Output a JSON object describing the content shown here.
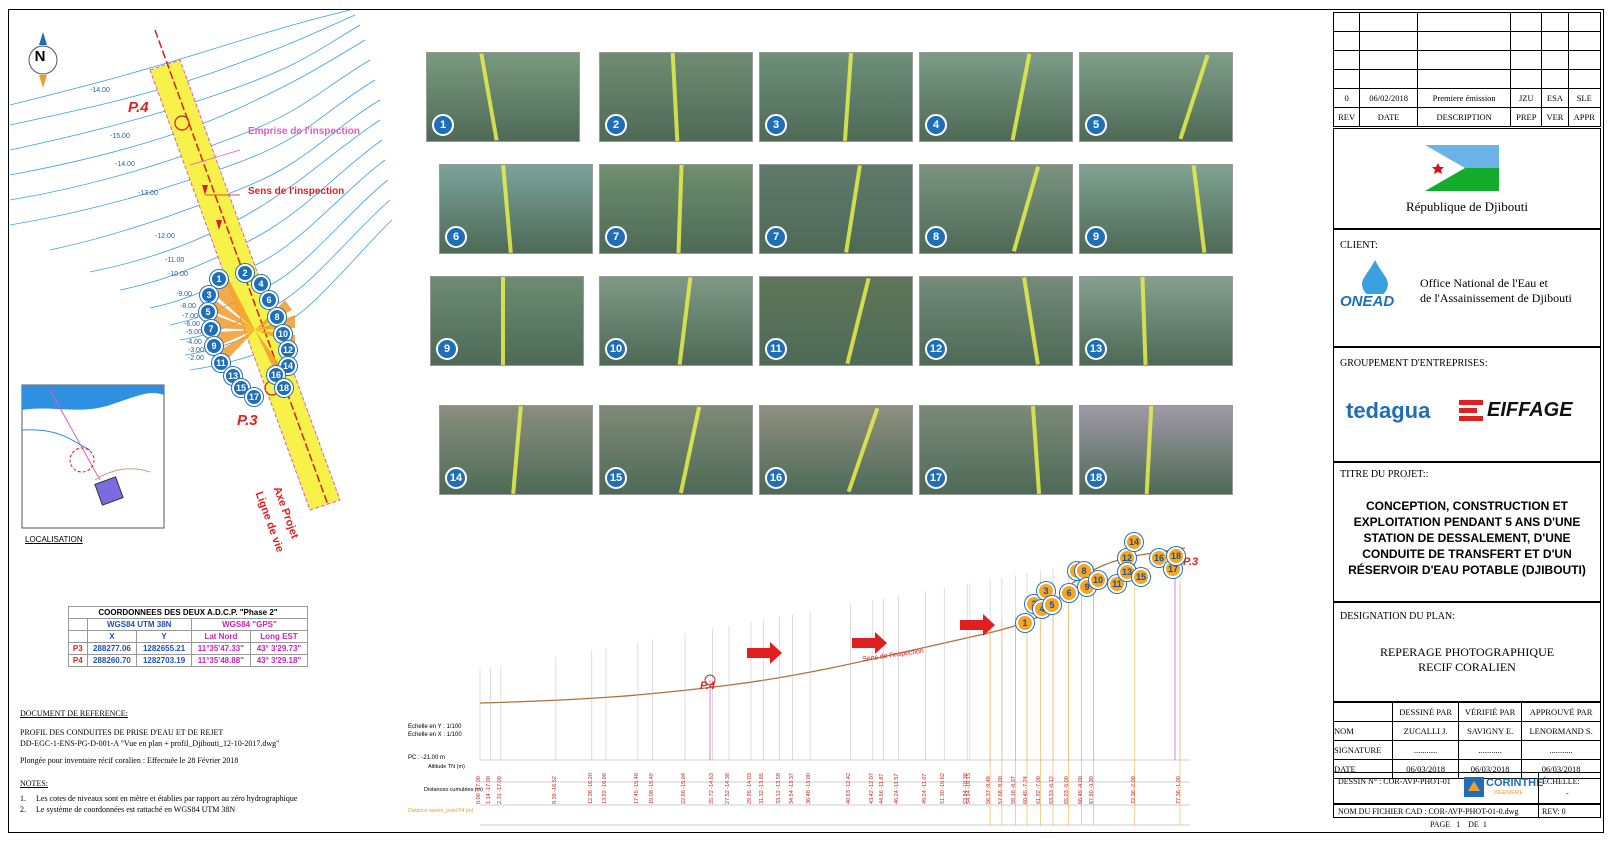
{
  "map": {
    "compass_label": "N",
    "labels": {
      "p4": "P.4",
      "p3": "P.3",
      "emprise": "Emprise de l'inspection",
      "sens": "Sens de l'inspection",
      "axe": "Axe Projet",
      "ligne": "Ligne de vie",
      "localisation": "LOCALISATION"
    },
    "contours": [
      "-14.00",
      "-15.00",
      "-14.00",
      "-13.00",
      "-12.00",
      "-11.00",
      "-10.00",
      "-9.00",
      "-8.00",
      "-7.00",
      "-6.00",
      "-5.00",
      "-4.00",
      "-3.00",
      "-2.00"
    ],
    "pins": [
      "1",
      "2",
      "3",
      "4",
      "5",
      "6",
      "7",
      "8",
      "9",
      "10",
      "11",
      "12",
      "13",
      "14",
      "15",
      "16",
      "17",
      "18"
    ]
  },
  "coordinates": {
    "title": "COORDONNEES DES DEUX A.D.C.P. \"Phase 2\"",
    "col_utm": "WGS84 UTM 38N",
    "col_gps": "WGS84 \"GPS\"",
    "sub": [
      "X",
      "Y",
      "Lat Nord",
      "Long EST"
    ],
    "rows": [
      {
        "name": "P3",
        "x": "288277.06",
        "y": "1282655.21",
        "lat": "11°35'47.33\"",
        "long": "43° 3'29.73\""
      },
      {
        "name": "P4",
        "x": "288260.70",
        "y": "1282703.19",
        "lat": "11°35'48.88\"",
        "long": "43° 3'29.18\""
      }
    ]
  },
  "reference": {
    "title": "DOCUMENT DE REFERENCE:",
    "line1": "PROFIL DES CONDUITES DE PRISE D'EAU ET DE REJET",
    "line2": "DD-EGC-1-ENS-PG-D-001-A \"Vue en plan + profil_Djibouti_12-10-2017.dwg\"",
    "line3": "Plongée pour inventaire récif coralien : Effectuée le 28 Février 2018",
    "notes_title": "NOTES:",
    "note1": "Les cotes de niveaux sont en mètre et établies par rapport au zéro hydrographique",
    "note2": "Le système de coordonnées est rattaché en WGS84 UTM 38N"
  },
  "photos": [
    {
      "num": "1",
      "color": "#7a9a7e"
    },
    {
      "num": "2",
      "color": "#6f8c72"
    },
    {
      "num": "3",
      "color": "#6d9079"
    },
    {
      "num": "4",
      "color": "#7b9c86"
    },
    {
      "num": "5",
      "color": "#7f9f88"
    },
    {
      "num": "6",
      "color": "#7aa39a"
    },
    {
      "num": "7",
      "color": "#6f8f6e"
    },
    {
      "num": "7",
      "color": "#5f7a6c"
    },
    {
      "num": "8",
      "color": "#7a9480"
    },
    {
      "num": "9",
      "color": "#7fa392"
    },
    {
      "num": "9",
      "color": "#6d8c73"
    },
    {
      "num": "10",
      "color": "#7e9a86"
    },
    {
      "num": "11",
      "color": "#5f7759"
    },
    {
      "num": "12",
      "color": "#748b7a"
    },
    {
      "num": "13",
      "color": "#85a08e"
    },
    {
      "num": "14",
      "color": "#8a8f7f"
    },
    {
      "num": "15",
      "color": "#7f8a78"
    },
    {
      "num": "16",
      "color": "#8f8f80"
    },
    {
      "num": "17",
      "color": "#7c8a78"
    },
    {
      "num": "18",
      "color": "#a09aa6"
    }
  ],
  "profile": {
    "p4": "P.4",
    "p3": "P.3",
    "sens": "Sens de l'inspection",
    "scale_y": "Echelle en Y : 1/100",
    "scale_x": "Echelle en X : 1/100",
    "pc": "PC : -21.00 m",
    "row1": "Altitude TN (m)",
    "row2": "Distances cumulées (m)",
    "row3": "Distance repere_point P4 (m)",
    "pins": [
      "1",
      "2",
      "3",
      "4",
      "5",
      "6",
      "7",
      "8",
      "9",
      "10",
      "11",
      "12",
      "13",
      "14",
      "15",
      "16",
      "17",
      "18"
    ],
    "values": [
      "0.00 -17.00",
      "1.14 -17.00",
      "2.31 -17.00",
      "8.39 -16.52",
      "12.36 -16.20",
      "13.92 -16.08",
      "17.45 -15.48",
      "19.08 -15.49",
      "22.66 -15.04",
      "25.72 -14.63",
      "27.52 -14.38",
      "29.95 -14.03",
      "31.32 -13.85",
      "33.12 -13.58",
      "34.54 -13.37",
      "36.48 -13.00",
      "40.93 -12.42",
      "43.42 -12.07",
      "44.56 -11.87",
      "46.24 -11.57",
      "49.24 -11.07",
      "51.30 -10.62",
      "53.84 -10.38",
      "54.14 -10.15",
      "56.37 -9.48",
      "57.68 -9.00",
      "59.18 -8.37",
      "60.45 -7.74",
      "61.92 -7.00",
      "63.33 -6.12",
      "65.03 -5.00",
      "66.49 -4.00",
      "67.80 -3.30",
      "72.36 -2.00",
      "77.36 -1.00"
    ]
  },
  "title_block": {
    "rev_row": [
      "0",
      "06/02/2018",
      "Premiere émission",
      "JZU",
      "ESA",
      "SLE"
    ],
    "rev_header": [
      "REV",
      "DATE",
      "DESCRIPTION",
      "PREP",
      "VER",
      "APPR"
    ],
    "country": "République de Djibouti",
    "client_label": "CLIENT:",
    "client_name1": "Office National de l'Eau et",
    "client_name2": "de l'Assainissement de Djibouti",
    "client_logo": "ONEAD",
    "group_label": "GROUPEMENT D'ENTREPRISES:",
    "logo1": "tedagua",
    "logo2": "EIFFAGE",
    "project_label": "TITRE DU PROJET::",
    "project_lines": [
      "CONCEPTION, CONSTRUCTION ET",
      "EXPLOITATION PENDANT 5 ANS D'UNE",
      "STATION DE DESSALEMENT, D'UNE",
      "CONDUITE DE TRANSFERT ET D'UN",
      "RÉSERVOIR D'EAU POTABLE (DJIBOUTI)"
    ],
    "design_label": "DESIGNATION DU PLAN:",
    "design_lines": [
      "REPERAGE PHOTOGRAPHIQUE",
      "RECIF CORALIEN"
    ],
    "sig_header": [
      "",
      "DESSINÉ PAR",
      "VÉRIFIÉ PAR",
      "APPROUVÉ PAR"
    ],
    "sig_rows": [
      [
        "NOM",
        "ZUCALLI J.",
        "SAVIGNY E.",
        "LENORMAND S."
      ],
      [
        "SIGNATURE",
        "...........",
        "...........",
        "..........."
      ],
      [
        "DATE",
        "06/03/2018",
        "06/03/2018",
        "06/03/2018"
      ]
    ],
    "dessin": "DESSIN N° : COR-AVP-PHOT-01",
    "echelle": "ÉCHELLE:",
    "echelle_val": "-",
    "corinthe": "CORINTHE",
    "corinthe_sub": "INGÉNIERIE",
    "fichier": "NOM DU FICHIER CAD : COR-AVP-PHOT-01-0.dwg",
    "rev": "REV: 0",
    "page": "PAGE",
    "page_num": "1",
    "de": "DE",
    "de_num": "1"
  }
}
